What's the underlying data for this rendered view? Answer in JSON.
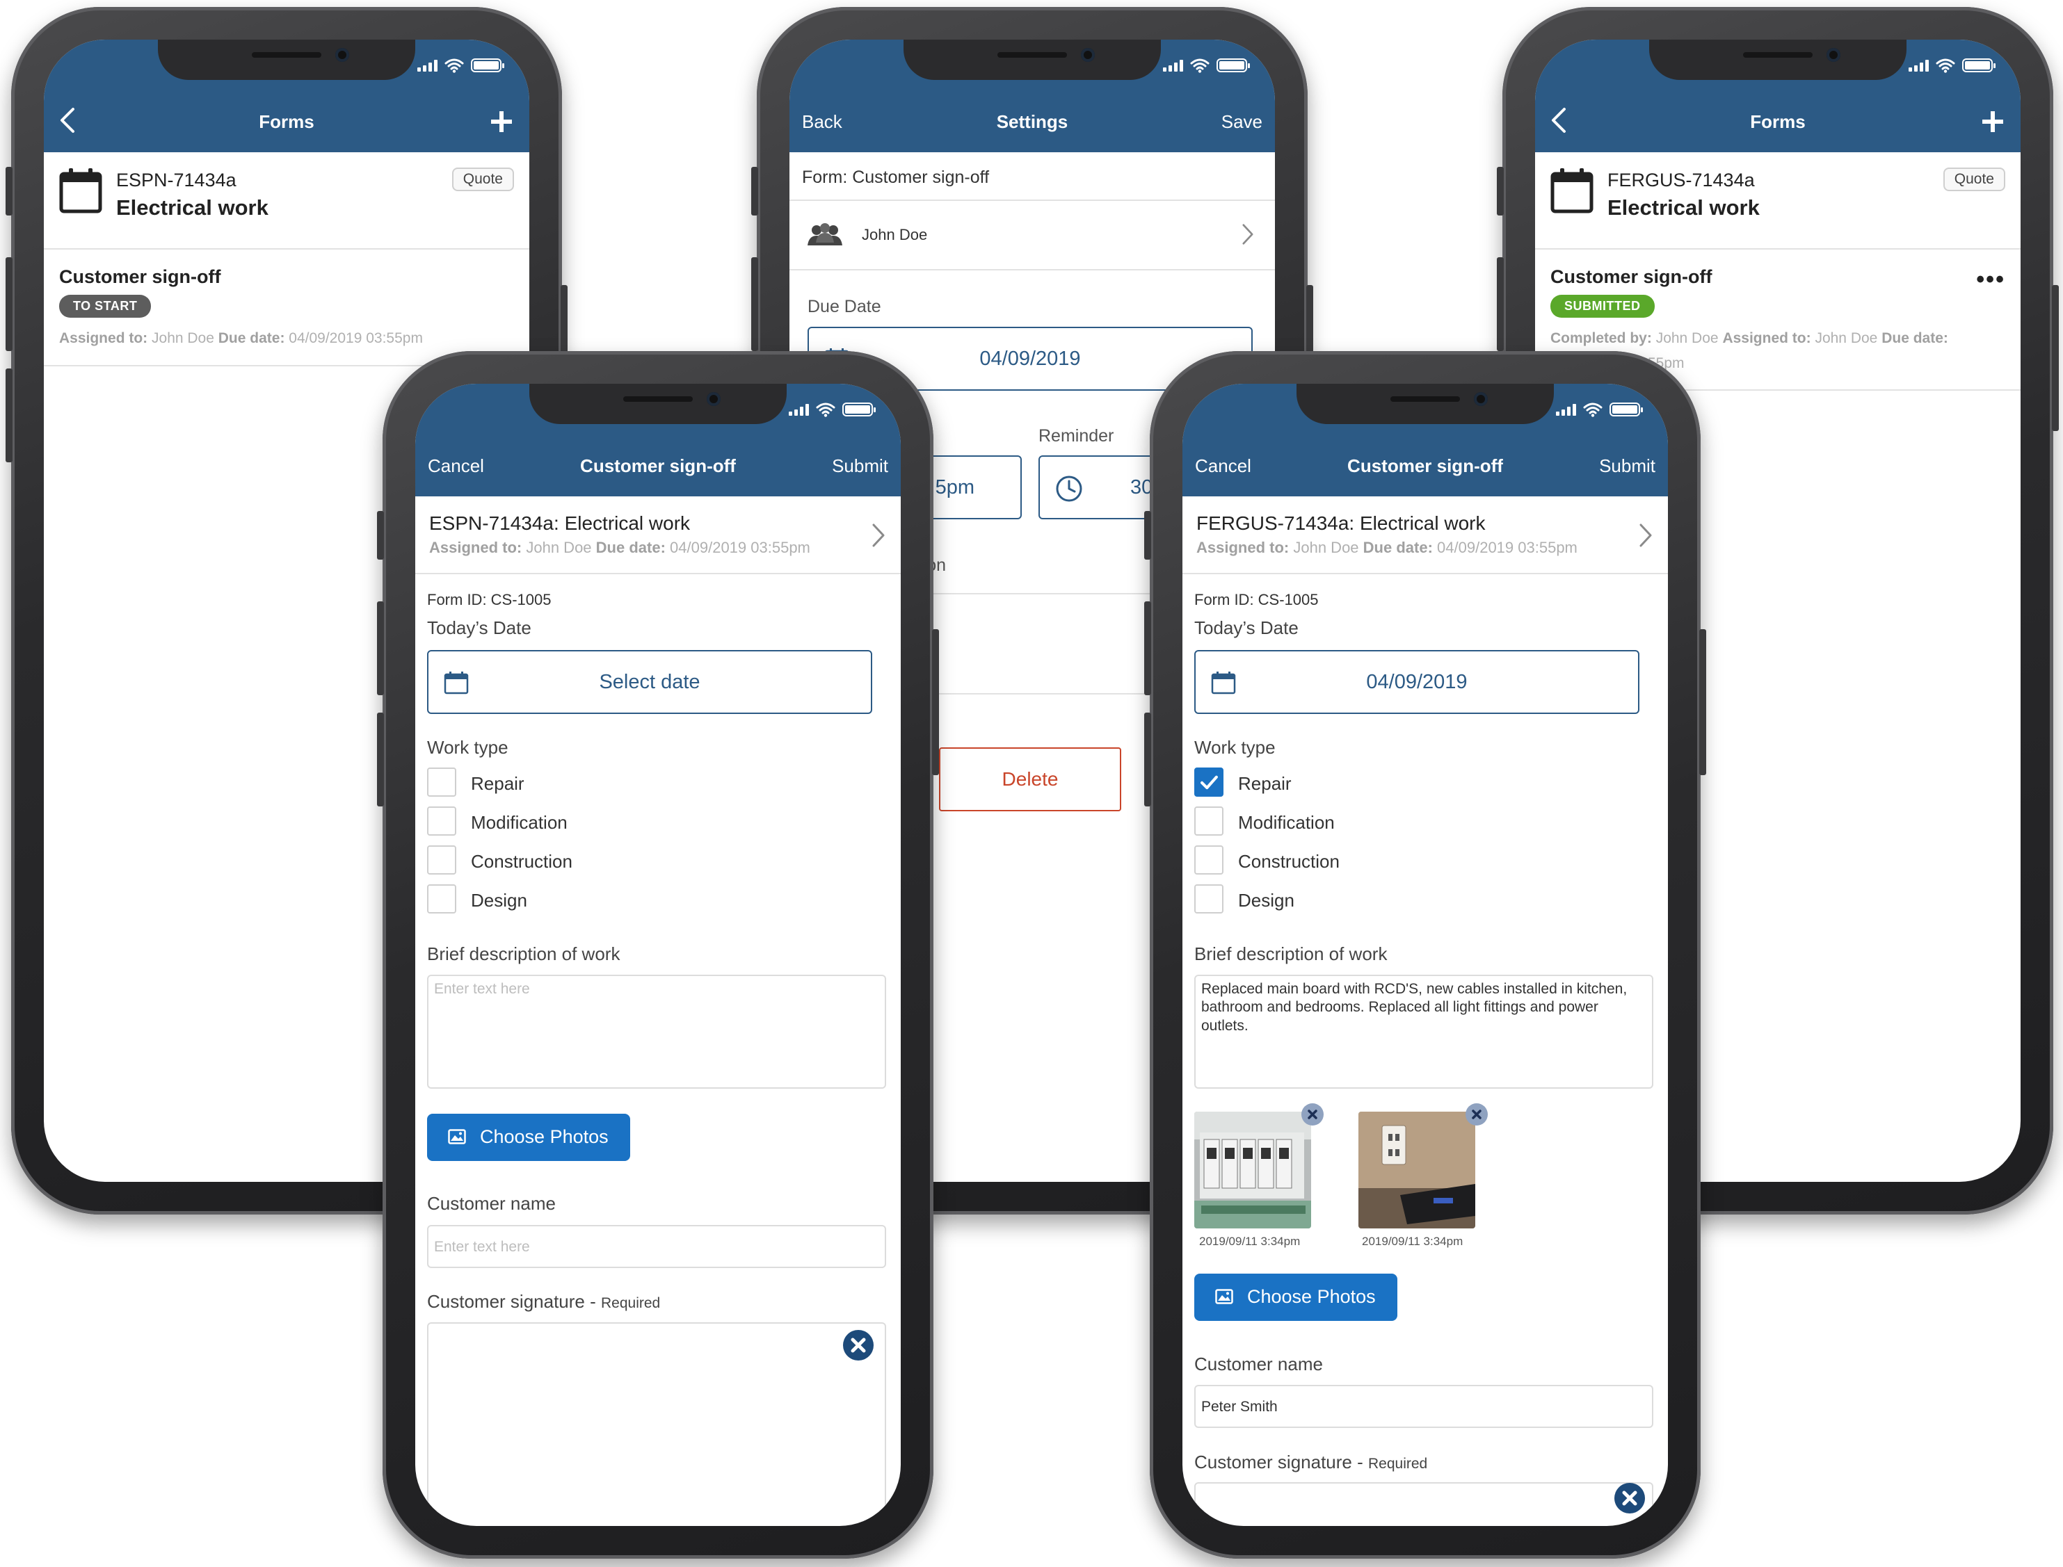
{
  "colors": {
    "header": "#2c5a85",
    "accent": "#1a72c4",
    "success": "#5aa82a",
    "danger": "#c9452a"
  },
  "phone_forms_1": {
    "header": {
      "title": "Forms",
      "left_icon": "chevron-left-icon",
      "right_icon": "plus-icon"
    },
    "job": {
      "code": "ESPN-71434a",
      "name": "Electrical work",
      "tag": "Quote"
    },
    "form": {
      "title": "Customer sign-off",
      "status": "TO START",
      "assigned_label": "Assigned to:",
      "assigned_value": "John Doe",
      "due_label": "Due date:",
      "due_value": "04/09/2019 03:55pm"
    }
  },
  "phone_settings": {
    "header": {
      "left": "Back",
      "title": "Settings",
      "right": "Save"
    },
    "form_row": "Form: Customer sign-off",
    "user_row": "John Doe",
    "due_date_label": "Due Date",
    "due_date_value": "04/09/2019",
    "reminder_label": "Reminder",
    "time_value_partial": "5pm",
    "reminder_value_partial": "30",
    "info_partial": "mation",
    "delete_label": "Delete"
  },
  "phone_forms_2": {
    "header": {
      "title": "Forms",
      "left_icon": "chevron-left-icon",
      "right_icon": "plus-icon"
    },
    "job": {
      "code": "FERGUS-71434a",
      "name": "Electrical work",
      "tag": "Quote"
    },
    "form": {
      "title": "Customer sign-off",
      "status": "SUBMITTED",
      "completed_label": "Completed by:",
      "completed_value": "John Doe",
      "assigned_label": "Assigned to:",
      "assigned_value": "John Doe",
      "due_label": "Due date:",
      "due_value_partial": "55pm",
      "menu_icon": "more-dots-icon"
    }
  },
  "phone_signoff_empty": {
    "header": {
      "left": "Cancel",
      "title": "Customer sign-off",
      "right": "Submit"
    },
    "job_line": "ESPN-71434a: Electrical work",
    "assigned_label": "Assigned to:",
    "assigned_value": "John Doe",
    "due_label": "Due date:",
    "due_value": "04/09/2019 03:55pm",
    "form_id": "Form ID: CS-1005",
    "todays_date_label": "Today’s Date",
    "date_value": "Select date",
    "work_type_label": "Work type",
    "work_types": [
      {
        "label": "Repair",
        "checked": false
      },
      {
        "label": "Modification",
        "checked": false
      },
      {
        "label": "Construction",
        "checked": false
      },
      {
        "label": "Design",
        "checked": false
      }
    ],
    "description_label": "Brief description of work",
    "description_placeholder": "Enter text here",
    "choose_photos": "Choose Photos",
    "customer_name_label": "Customer name",
    "customer_name_placeholder": "Enter text here",
    "signature_label": "Customer signature - ",
    "signature_required": "Required"
  },
  "phone_signoff_filled": {
    "header": {
      "left": "Cancel",
      "title": "Customer sign-off",
      "right": "Submit"
    },
    "job_line": "FERGUS-71434a: Electrical work",
    "assigned_label": "Assigned to:",
    "assigned_value": "John Doe",
    "due_label": "Due date:",
    "due_value": "04/09/2019 03:55pm",
    "form_id": "Form ID: CS-1005",
    "todays_date_label": "Today’s Date",
    "date_value": "04/09/2019",
    "work_type_label": "Work type",
    "work_types": [
      {
        "label": "Repair",
        "checked": true
      },
      {
        "label": "Modification",
        "checked": false
      },
      {
        "label": "Construction",
        "checked": false
      },
      {
        "label": "Design",
        "checked": false
      }
    ],
    "description_label": "Brief description of work",
    "description_value": "Replaced main board with RCD'S, new cables installed in kitchen, bathroom and bedrooms. Replaced all light fittings and power outlets.",
    "photos": [
      {
        "caption": "2019/09/11 3:34pm"
      },
      {
        "caption": "2019/09/11 3:34pm"
      }
    ],
    "choose_photos": "Choose Photos",
    "customer_name_label": "Customer name",
    "customer_name_value": "Peter Smith",
    "signature_label": "Customer signature - ",
    "signature_required": "Required"
  }
}
